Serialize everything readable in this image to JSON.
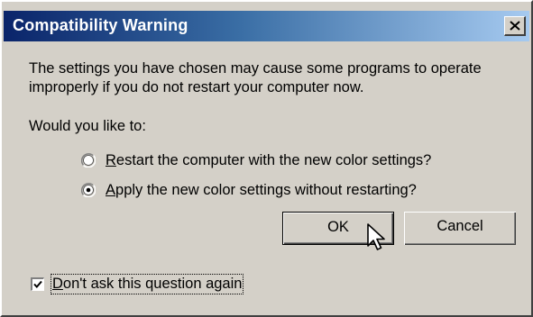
{
  "window": {
    "title": "Compatibility Warning",
    "close_icon": "close-icon"
  },
  "message": "The settings you have chosen may cause some programs to operate improperly if you do not restart your computer now.",
  "prompt": "Would you like to:",
  "options": [
    {
      "mnemonic": "R",
      "rest": "estart the computer with the new color settings?",
      "selected": false
    },
    {
      "mnemonic": "A",
      "rest": "pply the new color settings without restarting?",
      "selected": true
    }
  ],
  "buttons": {
    "ok": "OK",
    "cancel": "Cancel"
  },
  "checkbox": {
    "mnemonic": "D",
    "rest": "on't ask this question again",
    "checked": true
  },
  "colors": {
    "dialog_bg": "#d4d0c8",
    "title_start": "#0a246a",
    "title_end": "#a6caf0",
    "title_text": "#ffffff"
  }
}
